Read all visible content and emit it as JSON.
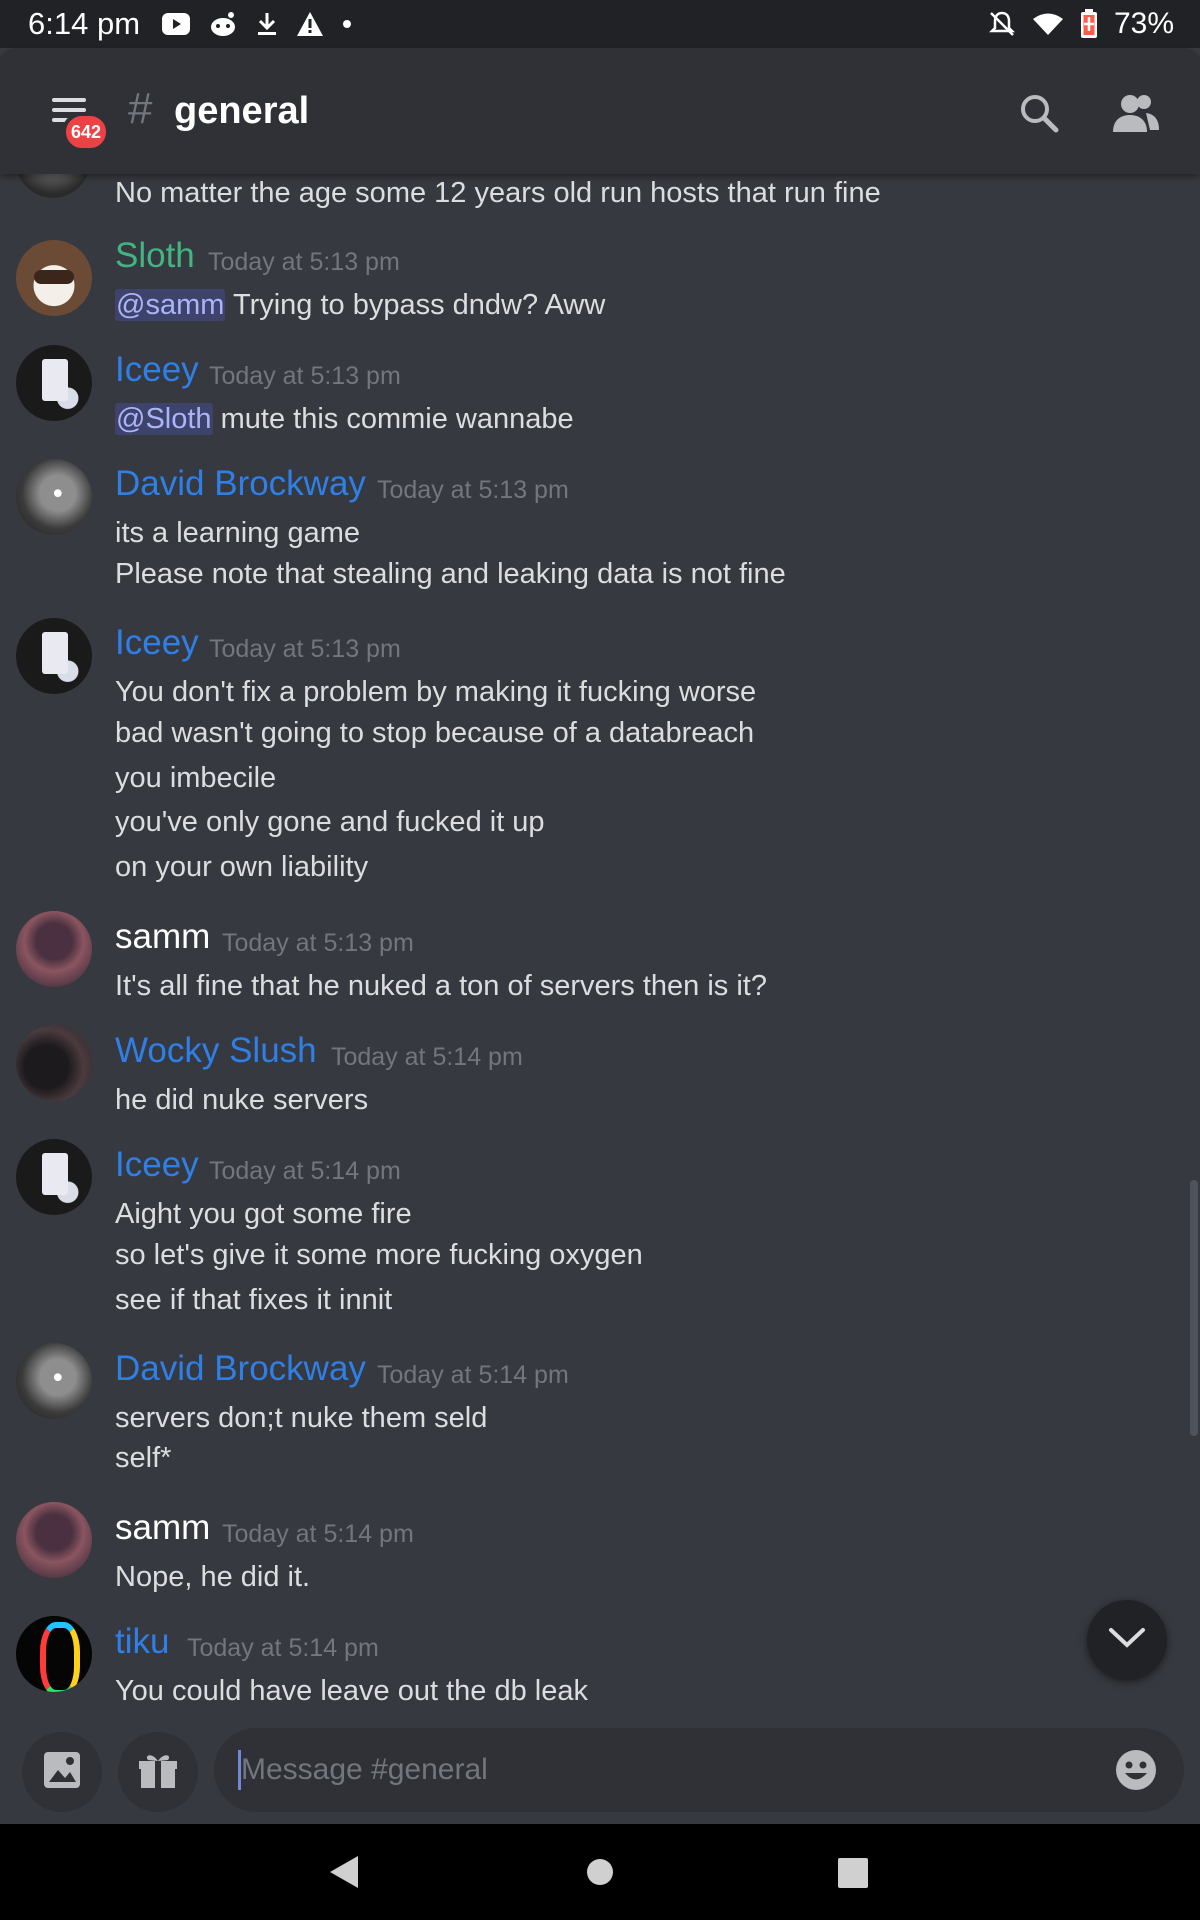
{
  "status_bar": {
    "time": "6:14 pm",
    "battery": "73%"
  },
  "header": {
    "badge_count": "642",
    "hash_symbol": "#",
    "channel": "general"
  },
  "prev_message": {
    "text": "No matter the age some 12 years old run hosts that run fine"
  },
  "messages": [
    {
      "author": "Sloth",
      "timestamp": "Today at 5:13 pm",
      "mention": "@samm",
      "lines": [
        "Trying to bypass dndw? Aww"
      ]
    },
    {
      "author": "Iceey",
      "timestamp": "Today at 5:13 pm",
      "mention": "@Sloth",
      "lines": [
        "mute this commie wannabe"
      ]
    },
    {
      "author": "David Brockway",
      "timestamp": "Today at 5:13 pm",
      "lines": [
        "its a learning game",
        "Please note that stealing and leaking data is not fine"
      ]
    },
    {
      "author": "Iceey",
      "timestamp": "Today at 5:13 pm",
      "lines": [
        "You don't fix a problem by making it fucking worse",
        "bad wasn't going to stop because of a databreach",
        "you imbecile",
        "you've only gone and fucked it up",
        "on your own liability"
      ]
    },
    {
      "author": "samm",
      "timestamp": "Today at 5:13 pm",
      "lines": [
        "It's all fine that he nuked a ton of servers then is it?"
      ]
    },
    {
      "author": "Wocky Slush",
      "timestamp": "Today at 5:14 pm",
      "lines": [
        "he did nuke servers"
      ]
    },
    {
      "author": "Iceey",
      "timestamp": "Today at 5:14 pm",
      "lines": [
        "Aight you got some fire",
        "so let's give it some more fucking oxygen",
        "see if that fixes it innit"
      ]
    },
    {
      "author": "David Brockway",
      "timestamp": "Today at 5:14 pm",
      "lines": [
        "servers don;t nuke them seld",
        "self*"
      ]
    },
    {
      "author": "samm",
      "timestamp": "Today at 5:14 pm",
      "lines": [
        "Nope, he did it."
      ]
    },
    {
      "author": "tiku",
      "timestamp": "Today at 5:14 pm",
      "lines": [
        "You could have leave out the db leak"
      ]
    }
  ],
  "input": {
    "placeholder": "Message #general"
  },
  "icons": [
    "youtube-icon",
    "reddit-icon",
    "download-icon",
    "warning-icon",
    "notifications-off-icon",
    "wifi-icon",
    "battery-icon",
    "menu-icon",
    "search-icon",
    "members-icon",
    "chevron-down-icon",
    "image-icon",
    "gift-icon",
    "emoji-icon",
    "back-icon",
    "home-icon",
    "recents-icon"
  ],
  "colors": {
    "background": "#36393f",
    "header": "#2f3136",
    "name_blue": "#2f7fe6",
    "name_green": "#43b581",
    "badge_red": "#ed4245",
    "mention": "#aab4f7"
  }
}
